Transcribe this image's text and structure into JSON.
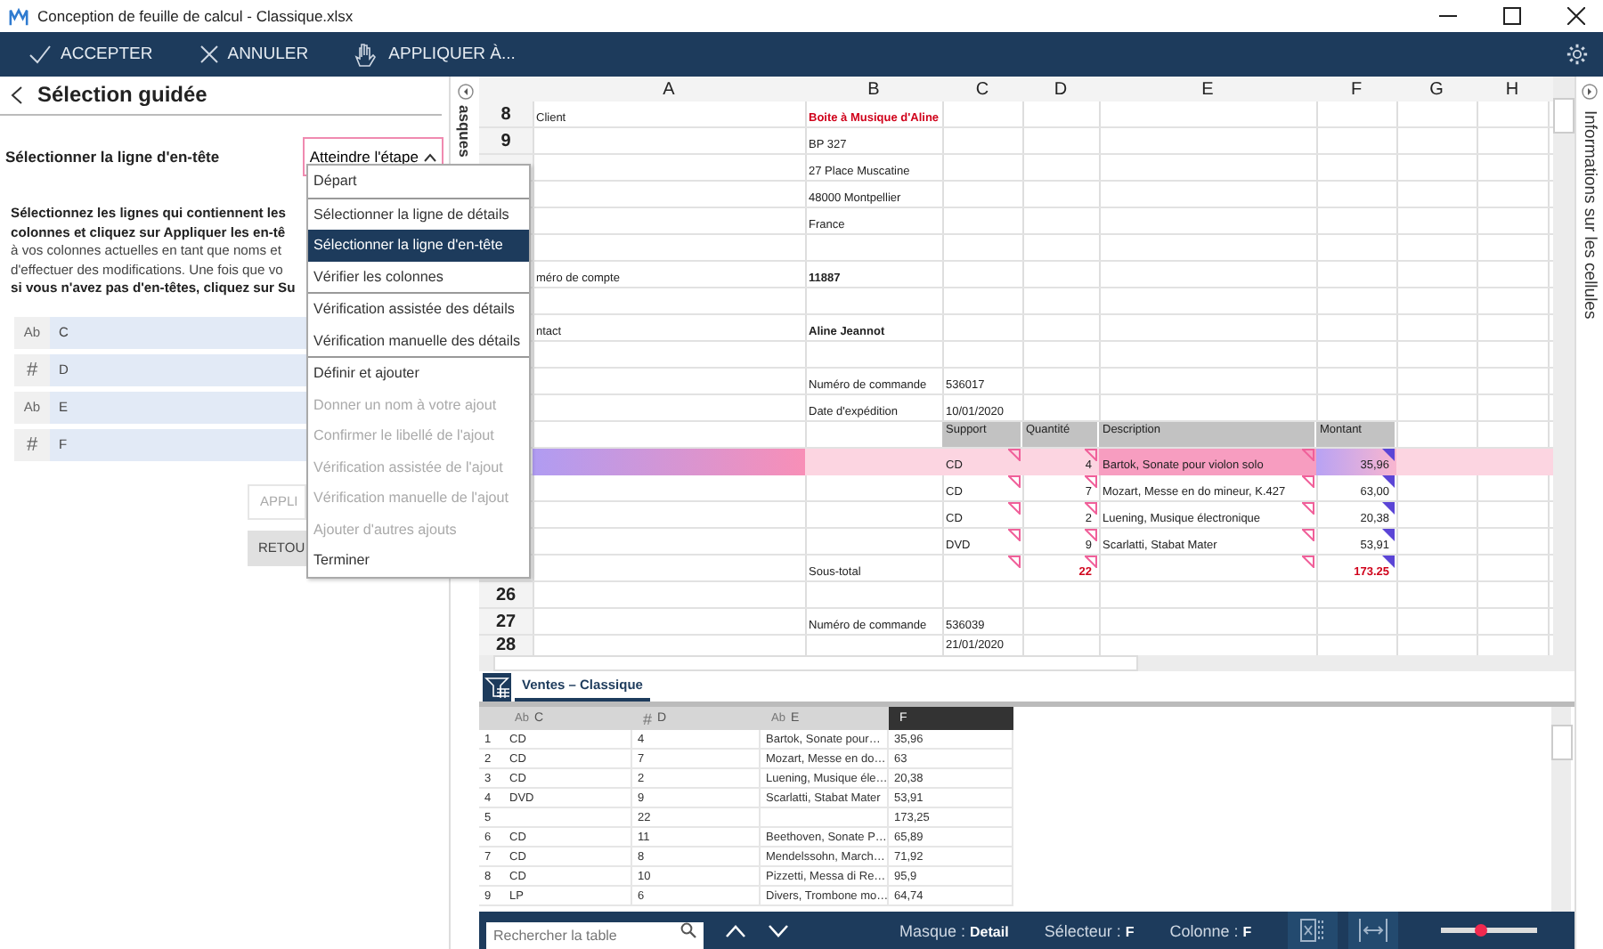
{
  "window": {
    "title": "Conception de feuille de calcul - Classique.xlsx"
  },
  "toolbar": [
    {
      "label": "ACCEPTER",
      "kind": "check"
    },
    {
      "label": "ANNULER",
      "kind": "cross"
    },
    {
      "label": "APPLIQUER À...",
      "kind": "hand"
    }
  ],
  "panel": {
    "title": "Sélection guidée",
    "step_label": "Sélectionner la ligne d'en-tête",
    "step_button": "Atteindre l'étape",
    "lines": [
      {
        "text": "Sélectionnez les lignes qui contiennent les",
        "bold": true
      },
      {
        "text": "colonnes et cliquez sur Appliquer les en-tê",
        "bold": true
      },
      {
        "text": "à vos colonnes actuelles en tant que noms et",
        "bold": false
      },
      {
        "text": "d'effectuer des modifications. Une fois que vo",
        "bold": false
      },
      {
        "text": "si vous n'avez pas d'en-têtes, cliquez sur Su",
        "bold": true
      }
    ],
    "fields": [
      {
        "type": "Ab",
        "name": "C"
      },
      {
        "type": "#",
        "name": "D"
      },
      {
        "type": "Ab",
        "name": "E"
      },
      {
        "type": "#",
        "name": "F"
      }
    ],
    "buttons": [
      {
        "label": "APPLI",
        "kind": "outline"
      },
      {
        "label": "RETOU",
        "kind": "filled"
      }
    ],
    "side_tab": "asques"
  },
  "step_menu": {
    "groups": [
      [
        {
          "label": "Départ",
          "selected": false,
          "disabled": false
        }
      ],
      [
        {
          "label": "Sélectionner la ligne de détails",
          "selected": false,
          "disabled": false
        },
        {
          "label": "Sélectionner la ligne d'en-tête",
          "selected": true,
          "disabled": false
        },
        {
          "label": "Vérifier les colonnes",
          "selected": false,
          "disabled": false
        }
      ],
      [
        {
          "label": "Vérification assistée des détails",
          "selected": false,
          "disabled": false
        },
        {
          "label": "Vérification manuelle des détails",
          "selected": false,
          "disabled": false
        }
      ],
      [
        {
          "label": "Définir et ajouter",
          "selected": false,
          "disabled": false
        },
        {
          "label": "Donner un nom à votre ajout",
          "selected": false,
          "disabled": true
        },
        {
          "label": "Confirmer le libellé de l'ajout",
          "selected": false,
          "disabled": true
        },
        {
          "label": "Vérification assistée de l'ajout",
          "selected": false,
          "disabled": true
        },
        {
          "label": "Vérification manuelle de l'ajout",
          "selected": false,
          "disabled": true
        },
        {
          "label": "Ajouter d'autres ajouts",
          "selected": false,
          "disabled": true
        },
        {
          "label": "Terminer",
          "selected": false,
          "disabled": false
        }
      ]
    ]
  },
  "sheet": {
    "columns": [
      "A",
      "B",
      "C",
      "D",
      "E",
      "F",
      "G",
      "H"
    ],
    "rows": [
      {
        "number": "8",
        "kind": "plain",
        "selected": false,
        "cells": [
          "Client",
          {
            "text": "Boite à Musique d'Aline",
            "kind": "alert"
          },
          null,
          null,
          null,
          null,
          null,
          null
        ]
      },
      {
        "number": "9",
        "kind": "plain",
        "selected": false,
        "cells": [
          null,
          "BP 327",
          null,
          null,
          null,
          null,
          null,
          null
        ]
      },
      {
        "kind": "plain",
        "selected": false,
        "cells": [
          null,
          "27 Place Muscatine",
          null,
          null,
          null,
          null,
          null,
          null
        ]
      },
      {
        "kind": "plain",
        "selected": false,
        "cells": [
          null,
          "48000 Montpellier",
          null,
          null,
          null,
          null,
          null,
          null
        ]
      },
      {
        "kind": "plain",
        "selected": false,
        "cells": [
          null,
          "France",
          null,
          null,
          null,
          null,
          null,
          null
        ]
      },
      {
        "kind": "plain",
        "selected": false,
        "cells": [
          null,
          null,
          null,
          null,
          null,
          null,
          null,
          null
        ]
      },
      {
        "kind": "plain",
        "selected": false,
        "cells": [
          "méro de compte",
          {
            "text": "11887",
            "kind": "strong"
          },
          null,
          null,
          null,
          null,
          null,
          null
        ]
      },
      {
        "kind": "plain",
        "selected": false,
        "cells": [
          null,
          null,
          null,
          null,
          null,
          null,
          null,
          null
        ]
      },
      {
        "kind": "plain",
        "selected": false,
        "cells": [
          "ntact",
          {
            "text": "Aline Jeannot",
            "kind": "strong"
          },
          null,
          null,
          null,
          null,
          null,
          null
        ]
      },
      {
        "kind": "plain",
        "selected": false,
        "cells": [
          null,
          null,
          null,
          null,
          null,
          null,
          null,
          null
        ]
      },
      {
        "kind": "plain",
        "selected": false,
        "cells": [
          null,
          "Numéro de commande",
          "536017",
          null,
          null,
          null,
          null,
          null
        ]
      },
      {
        "kind": "plain",
        "selected": false,
        "cells": [
          null,
          "Date d'expédition",
          "10/01/2020",
          null,
          null,
          null,
          null,
          null
        ]
      },
      {
        "kind": "header",
        "selected": false,
        "cells": [
          null,
          null,
          "Support",
          "Quantité",
          "Description",
          "Montant",
          null,
          null
        ]
      },
      {
        "kind": "item",
        "selected": true,
        "cells": [
          null,
          null,
          "CD",
          "4",
          "Bartok, Sonate pour violon solo",
          "35,96",
          null,
          null
        ]
      },
      {
        "kind": "item",
        "selected": false,
        "cells": [
          null,
          null,
          "CD",
          "7",
          "Mozart, Messe en do mineur, K.427",
          "63,00",
          null,
          null
        ]
      },
      {
        "kind": "item",
        "selected": false,
        "cells": [
          null,
          null,
          "CD",
          "2",
          "Luening, Musique électronique",
          "20,38",
          null,
          null
        ]
      },
      {
        "kind": "item",
        "selected": false,
        "cells": [
          null,
          null,
          "DVD",
          "9",
          "Scarlatti, Stabat Mater",
          "53,91",
          null,
          null
        ]
      },
      {
        "kind": "total",
        "selected": false,
        "cells": [
          null,
          "Sous-total",
          null,
          {
            "text": "22",
            "kind": "alert"
          },
          null,
          {
            "text": "173.25",
            "kind": "alert"
          },
          null,
          null
        ]
      },
      {
        "number": "26",
        "kind": "plain",
        "selected": false,
        "cells": [
          null,
          null,
          null,
          null,
          null,
          null,
          null,
          null
        ]
      },
      {
        "number": "27",
        "kind": "plain",
        "selected": false,
        "cells": [
          null,
          "Numéro de commande",
          "536039",
          null,
          null,
          null,
          null,
          null
        ]
      },
      {
        "number": "28",
        "kind": "plain",
        "selected": false,
        "cells": [
          null,
          null,
          "21/01/2020",
          null,
          null,
          null,
          null,
          null
        ]
      }
    ]
  },
  "table_tab": {
    "label": "Ventes – Classique",
    "selected": true
  },
  "table": {
    "columns": [
      {
        "type": "Ab",
        "name": "C",
        "selected": false
      },
      {
        "type": "#",
        "name": "D",
        "selected": false
      },
      {
        "type": "Ab",
        "name": "E",
        "selected": false
      },
      {
        "name": "F",
        "selected": true
      }
    ],
    "rows": [
      {
        "number": "1",
        "cells": [
          "CD",
          "4",
          "Bartok, Sonate pour…",
          "35,96"
        ]
      },
      {
        "number": "2",
        "cells": [
          "CD",
          "7",
          "Mozart, Messe en do…",
          "63"
        ]
      },
      {
        "number": "3",
        "cells": [
          "CD",
          "2",
          "Luening, Musique éle…",
          "20,38"
        ]
      },
      {
        "number": "4",
        "cells": [
          "DVD",
          "9",
          "Scarlatti, Stabat Mater",
          "53,91"
        ]
      },
      {
        "number": "5",
        "cells": [
          null,
          "22",
          null,
          "173,25"
        ]
      },
      {
        "number": "6",
        "cells": [
          "CD",
          "11",
          "Beethoven, Sonate P…",
          "65,89"
        ]
      },
      {
        "number": "7",
        "cells": [
          "CD",
          "8",
          "Mendelssohn, March…",
          "71,92"
        ]
      },
      {
        "number": "8",
        "cells": [
          "CD",
          "10",
          "Pizzetti, Messa di Re…",
          "95,9"
        ]
      },
      {
        "number": "9",
        "cells": [
          "LP",
          "6",
          "Divers, Trombone mo…",
          "64,74"
        ]
      }
    ]
  },
  "status_bar": {
    "search_placeholder": "Rechercher la table",
    "items": [
      {
        "label": "Masque :",
        "value": "Detail"
      },
      {
        "label": "Sélecteur :",
        "value": "F"
      },
      {
        "label": "Colonne :",
        "value": "F"
      }
    ],
    "zoom": {
      "level": 0.42
    }
  },
  "right_tab": "Informations sur les cellules"
}
